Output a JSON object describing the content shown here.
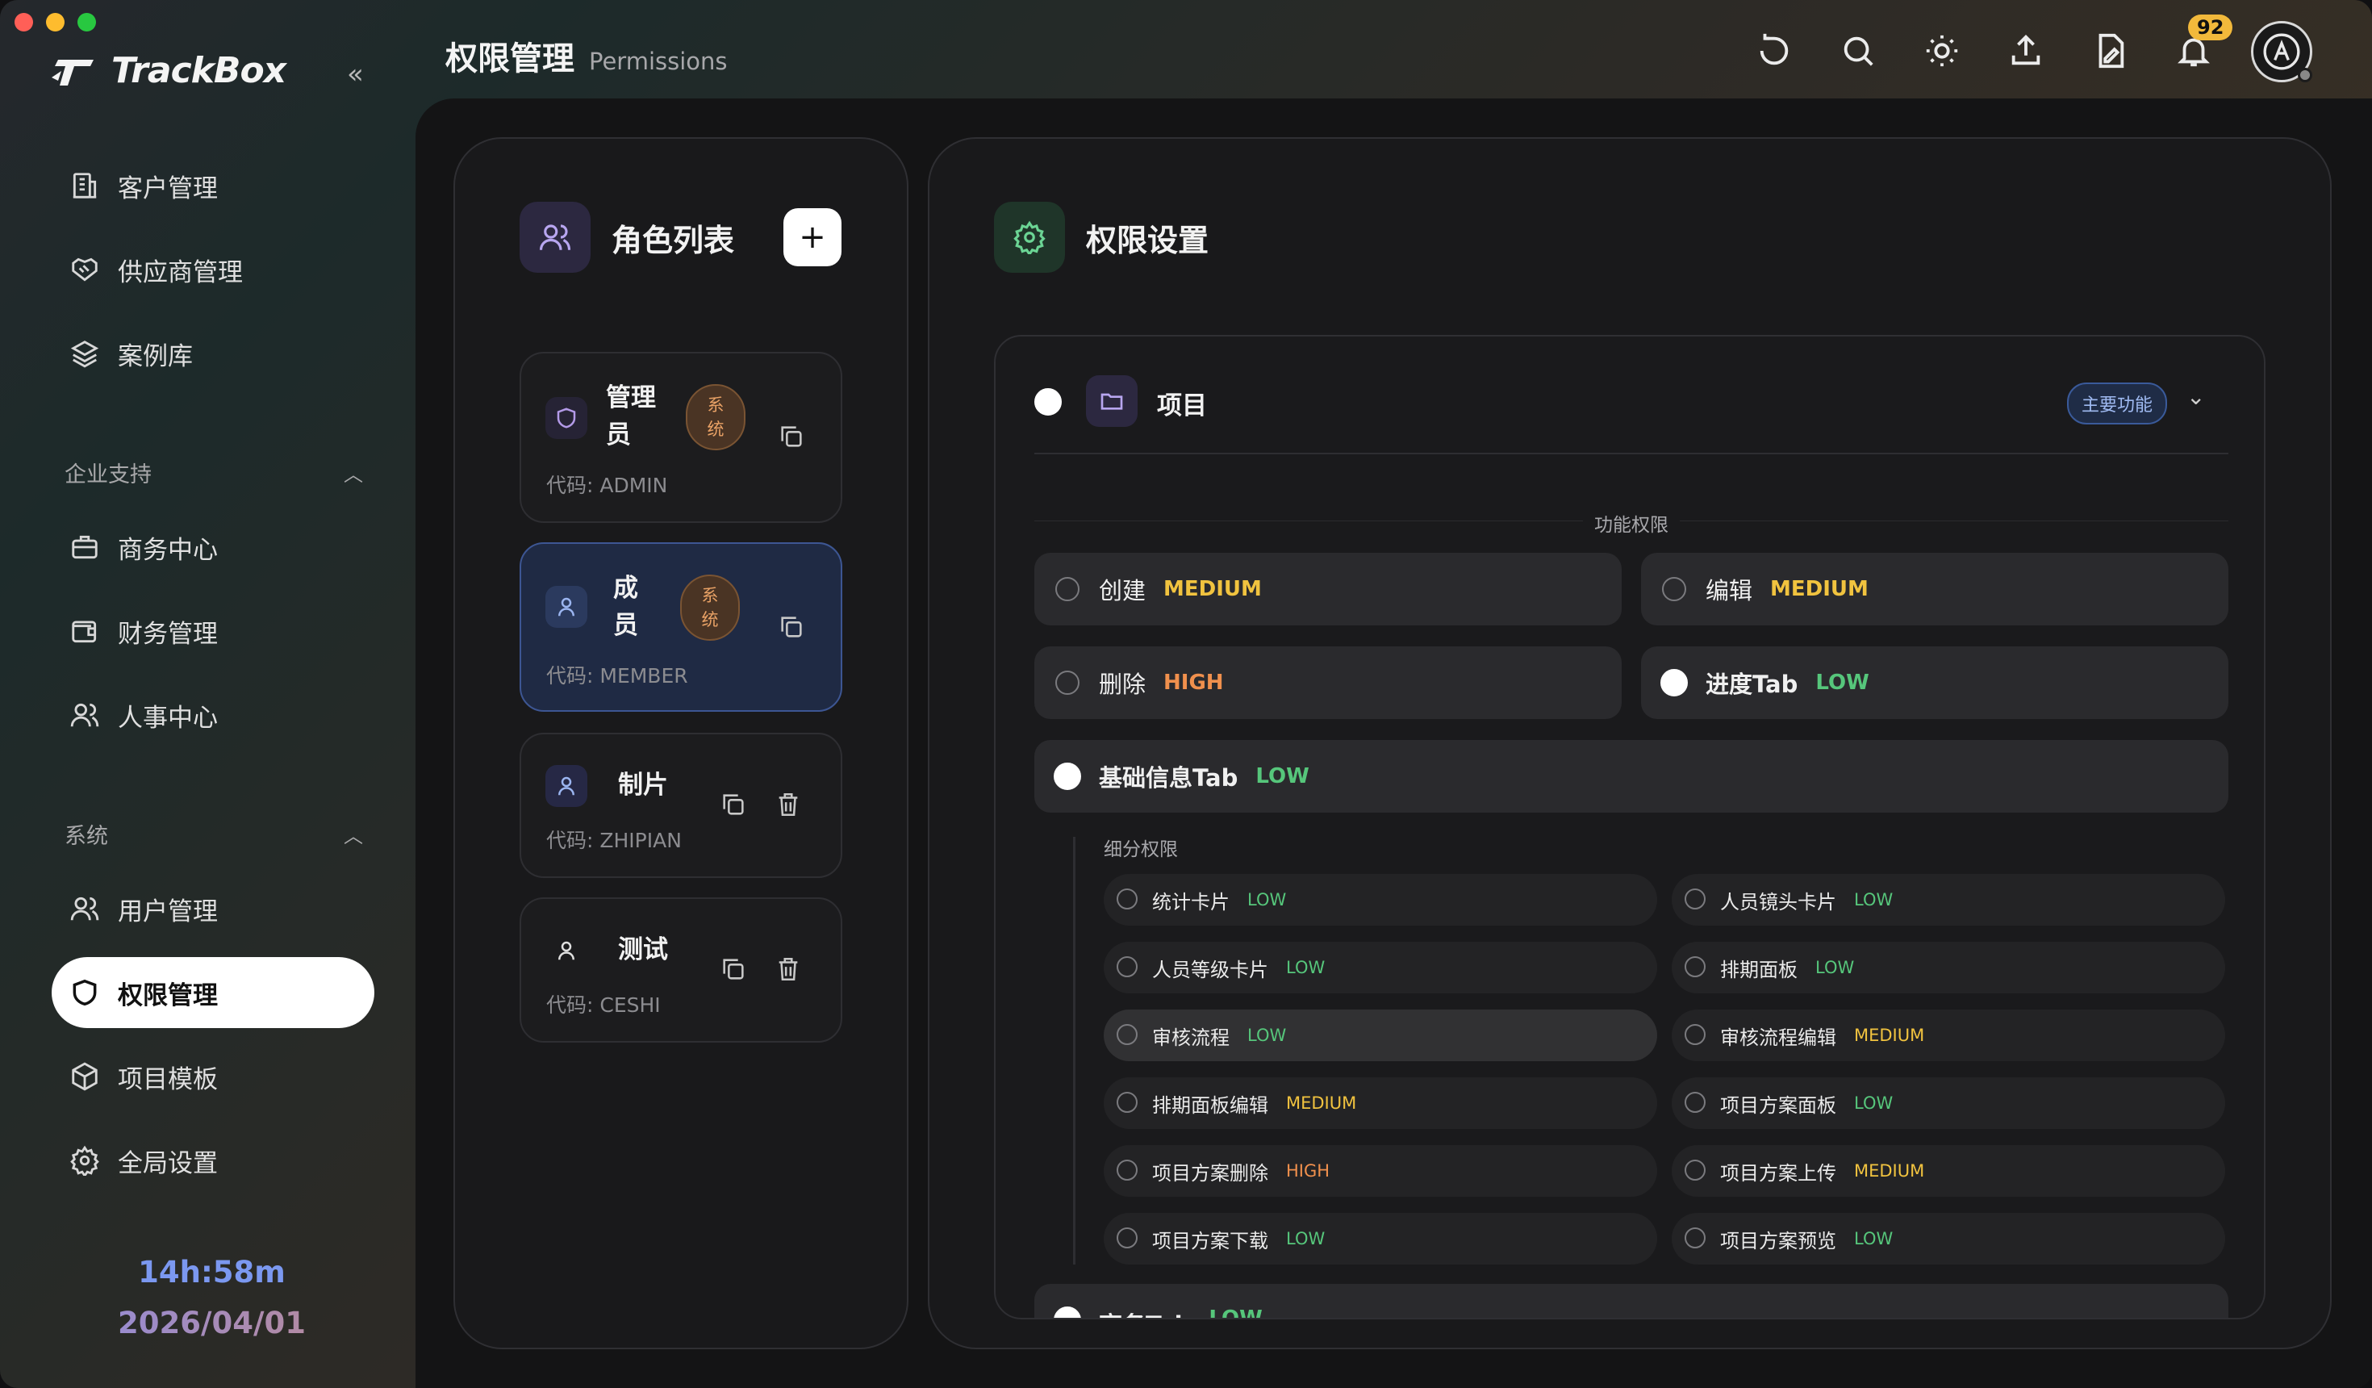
{
  "app": {
    "name": "TrackBox"
  },
  "header": {
    "title": "权限管理",
    "subtitle": "Permissions",
    "notification_count": "92"
  },
  "sidebar": {
    "items_top": [
      {
        "label": "客户管理",
        "icon": "building-icon"
      },
      {
        "label": "供应商管理",
        "icon": "handshake-icon"
      },
      {
        "label": "案例库",
        "icon": "layers-icon"
      }
    ],
    "section_enterprise": "企业支持",
    "items_enterprise": [
      {
        "label": "商务中心",
        "icon": "briefcase-icon"
      },
      {
        "label": "财务管理",
        "icon": "wallet-icon"
      },
      {
        "label": "人事中心",
        "icon": "users-icon"
      }
    ],
    "section_system": "系统",
    "items_system": [
      {
        "label": "用户管理",
        "icon": "users-icon"
      },
      {
        "label": "权限管理",
        "icon": "shield-icon",
        "active": true
      },
      {
        "label": "项目模板",
        "icon": "box-icon"
      },
      {
        "label": "全局设置",
        "icon": "gear-icon"
      }
    ],
    "clock_time": "14h:58m",
    "clock_date": "2026/04/01"
  },
  "roles_panel": {
    "title": "角色列表",
    "roles": [
      {
        "name": "管理员",
        "name_line1": "管理",
        "name_line2": "员",
        "system_tag": "系统",
        "tag_line1": "系",
        "tag_line2": "统",
        "code": "代码: ADMIN"
      },
      {
        "name": "成员",
        "name_line1": "成",
        "name_line2": "员",
        "system_tag": "系统",
        "tag_line1": "系",
        "tag_line2": "统",
        "code": "代码: MEMBER",
        "selected": true
      },
      {
        "name": "制片",
        "code": "代码: ZHIPIAN"
      },
      {
        "name": "测试",
        "code": "代码: CESHI"
      }
    ]
  },
  "settings_panel": {
    "title": "权限设置",
    "module": {
      "name": "项目",
      "tag": "主要功能"
    },
    "feature_section_label": "功能权限",
    "features": [
      {
        "label": "创建",
        "level": "MEDIUM",
        "checked": false
      },
      {
        "label": "编辑",
        "level": "MEDIUM",
        "checked": false
      },
      {
        "label": "删除",
        "level": "HIGH",
        "checked": false
      },
      {
        "label": "进度Tab",
        "level": "LOW",
        "checked": true
      }
    ],
    "group": {
      "label": "基础信息Tab",
      "level": "LOW",
      "checked": true
    },
    "sub_section_label": "细分权限",
    "sub_permissions": [
      {
        "label": "统计卡片",
        "level": "LOW"
      },
      {
        "label": "人员镜头卡片",
        "level": "LOW"
      },
      {
        "label": "人员等级卡片",
        "level": "LOW"
      },
      {
        "label": "排期面板",
        "level": "LOW"
      },
      {
        "label": "审核流程",
        "level": "LOW"
      },
      {
        "label": "审核流程编辑",
        "level": "MEDIUM"
      },
      {
        "label": "排期面板编辑",
        "level": "MEDIUM"
      },
      {
        "label": "项目方案面板",
        "level": "LOW"
      },
      {
        "label": "项目方案删除",
        "level": "HIGH"
      },
      {
        "label": "项目方案上传",
        "level": "MEDIUM"
      },
      {
        "label": "项目方案下载",
        "level": "LOW"
      },
      {
        "label": "项目方案预览",
        "level": "LOW"
      }
    ],
    "next_group": {
      "label": "商务Tab",
      "level": "LOW"
    }
  }
}
